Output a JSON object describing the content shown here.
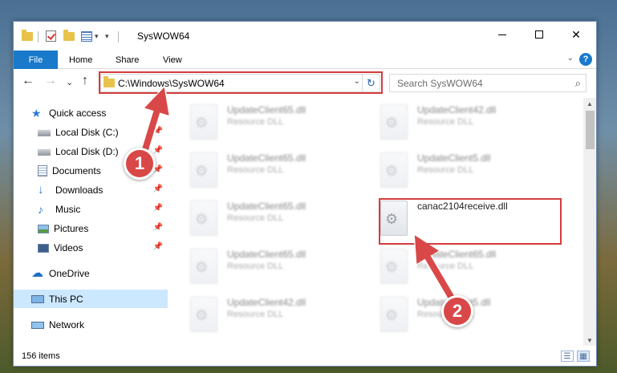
{
  "window": {
    "title": "SysWOW64",
    "controls": {
      "minimize": "",
      "maximize": "",
      "close": "✕"
    }
  },
  "quick_access_toolbar": {
    "dropdown": "▾"
  },
  "ribbon": {
    "tabs": [
      "File",
      "Home",
      "Share",
      "View"
    ],
    "expand_chevron": "⌄",
    "help": "?"
  },
  "navigation": {
    "back": "←",
    "forward": "→",
    "recent": "⌄",
    "up": "↑",
    "address": "C:\\Windows\\SysWOW64",
    "address_dropdown": "⌄",
    "refresh": "↻",
    "search_placeholder": "Search SysWOW64",
    "search_icon": "⌕"
  },
  "sidebar": {
    "items": [
      {
        "label": "Quick access",
        "icon": "star-icon",
        "pinned": false
      },
      {
        "label": "Local Disk (C:)",
        "icon": "drive-icon",
        "pinned": true
      },
      {
        "label": "Local Disk (D:)",
        "icon": "drive-icon",
        "pinned": true
      },
      {
        "label": "Documents",
        "icon": "documents-icon",
        "pinned": true
      },
      {
        "label": "Downloads",
        "icon": "download-icon",
        "pinned": true
      },
      {
        "label": "Music",
        "icon": "music-icon",
        "pinned": true
      },
      {
        "label": "Pictures",
        "icon": "pictures-icon",
        "pinned": true
      },
      {
        "label": "Videos",
        "icon": "videos-icon",
        "pinned": true
      },
      {
        "label": "OneDrive",
        "icon": "onedrive-icon",
        "pinned": false
      },
      {
        "label": "This PC",
        "icon": "computer-icon",
        "pinned": false,
        "selected": true
      },
      {
        "label": "Network",
        "icon": "network-icon",
        "pinned": false
      }
    ]
  },
  "files": [
    {
      "name": "UpdateClient65.dll",
      "type": "Resource DLL",
      "blurred": true
    },
    {
      "name": "UpdateClient42.dll",
      "type": "Resource DLL",
      "blurred": true
    },
    {
      "name": "UpdateClient65.dll",
      "type": "Resource DLL",
      "blurred": true
    },
    {
      "name": "UpdateClient5.dll",
      "type": "Resource DLL",
      "blurred": true
    },
    {
      "name": "UpdateClient65.dll",
      "type": "Resource DLL",
      "blurred": true
    },
    {
      "name": "canac2104receive.dll",
      "type": "",
      "blurred": false,
      "highlighted": true
    },
    {
      "name": "UpdateClient65.dll",
      "type": "Resource DLL",
      "blurred": true
    },
    {
      "name": "UpdateClient65.dll",
      "type": "Resource DLL",
      "blurred": true
    },
    {
      "name": "UpdateClient42.dll",
      "type": "Resource DLL",
      "blurred": true
    },
    {
      "name": "UpdateClient5.dll",
      "type": "Resource DLL",
      "blurred": true
    }
  ],
  "status": {
    "item_count": "156 items"
  },
  "annotations": {
    "step1": "1",
    "step2": "2",
    "color": "#d94848"
  }
}
